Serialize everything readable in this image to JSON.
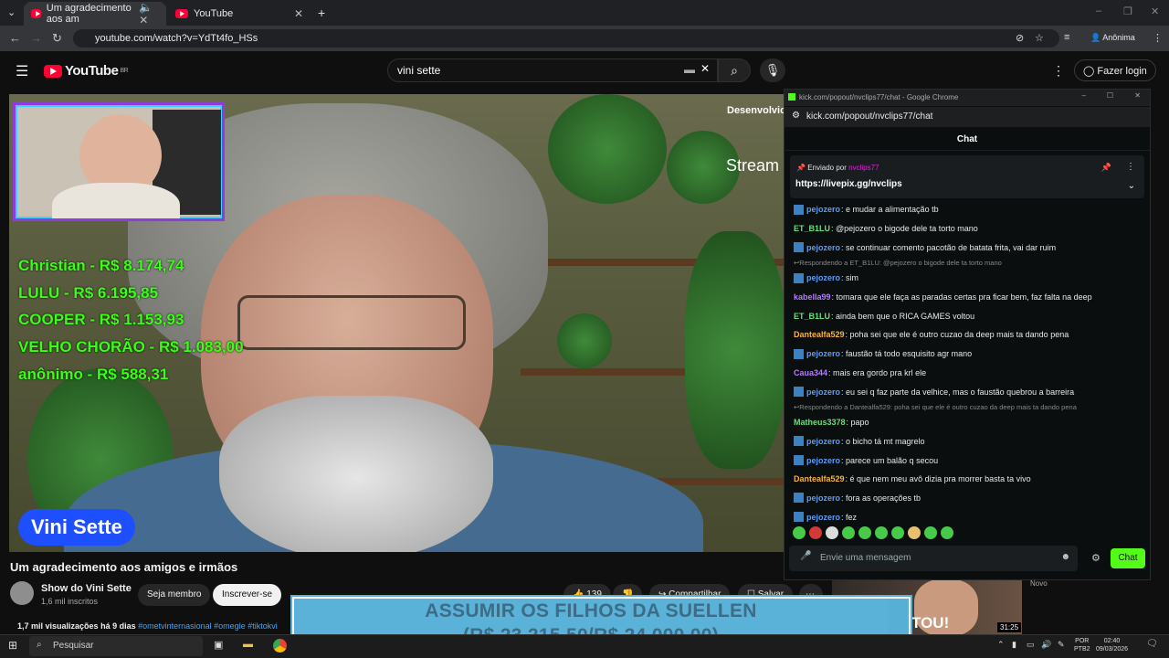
{
  "browser": {
    "tabs": [
      {
        "title": "Um agradecimento aos am"
      },
      {
        "title": "YouTube"
      }
    ],
    "url": "youtube.com/watch?v=YdTt4fo_HSs",
    "profile": "Anônima"
  },
  "youtube": {
    "logo_text": "YouTube",
    "region": "BR",
    "search_value": "vini sette",
    "login_label": "Fazer login",
    "video": {
      "overlay_donors": [
        "Christian - R$ 8.174,74",
        "LULU - R$ 6.195,85",
        "COOPER - R$ 1.153,93",
        "VELHO CHORÃO - R$ 1.083,00",
        "anônimo - R$ 588,31"
      ],
      "name_badge": "Vini Sette",
      "overlay_dev": "Desenvolvic",
      "overlay_stream": "Stream"
    },
    "title": "Um agradecimento aos amigos e irmãos",
    "channel": "Show do Vini Sette",
    "subscribers": "1,6 mil inscritos",
    "member_label": "Seja membro",
    "subscribe_label": "Inscrever-se",
    "likes": "139",
    "share_label": "Compartilhar",
    "save_label": "Salvar",
    "views": "1,7 mil visualizações",
    "age": "há 9 dias",
    "tags": "#ometvinternasional #omegle #tiktokvi",
    "related": {
      "badge": "Novo",
      "duration": "31:25",
      "thumb_text": "TOU!"
    },
    "banner": {
      "line1": "ASSUMIR OS FILHOS DA SUELLEN",
      "line2": "(R$ 23.215,50/R$ 24.000,00)"
    }
  },
  "chat_window": {
    "window_title": "kick.com/popout/nvclips77/chat - Google Chrome",
    "url": "kick.com/popout/nvclips77/chat",
    "header": "Chat",
    "pinned": {
      "sent_by": "Enviado por",
      "user": "nvclips77",
      "link": "https://livepix.gg/nvclips"
    },
    "messages": [
      {
        "user": "pejozero",
        "color": "#5b9df5",
        "badge": true,
        "text": ": e mudar a alimentação tb"
      },
      {
        "user": "ET_B1LU",
        "color": "#66e07a",
        "badge": false,
        "text": ": @pejozero o bigode dele ta torto mano"
      },
      {
        "user": "pejozero",
        "color": "#5b9df5",
        "badge": true,
        "text": ": se continuar comento pacotão de batata frita, vai dar ruim"
      },
      {
        "reply": "Respondendo a ET_B1LU: @pejozero o bigode dele ta torto mano"
      },
      {
        "user": "pejozero",
        "color": "#5b9df5",
        "badge": true,
        "text": ": sim"
      },
      {
        "user": "kabella99",
        "color": "#b47cff",
        "badge": false,
        "text": ": tomara que ele faça as paradas certas pra ficar bem, faz falta na deep"
      },
      {
        "user": "ET_B1LU",
        "color": "#66e07a",
        "badge": false,
        "text": ": ainda bem que o RICA GAMES voltou"
      },
      {
        "user": "Dantealfa529",
        "color": "#f5b342",
        "badge": false,
        "text": ": poha sei que ele é outro cuzao da deep mais ta dando pena"
      },
      {
        "user": "pejozero",
        "color": "#5b9df5",
        "badge": true,
        "text": ": faustão tá todo esquisito agr mano"
      },
      {
        "user": "Caua344",
        "color": "#b47cff",
        "badge": false,
        "text": ": mais era gordo pra krl ele"
      },
      {
        "user": "pejozero",
        "color": "#5b9df5",
        "badge": true,
        "text": ": eu sei q faz parte da velhice, mas o faustão quebrou a barreira"
      },
      {
        "reply": "Respondendo a Dantealfa529: poha sei que ele é outro cuzao da deep mais ta dando pena"
      },
      {
        "user": "Matheus3378",
        "color": "#66e07a",
        "badge": false,
        "text": ": papo"
      },
      {
        "user": "pejozero",
        "color": "#5b9df5",
        "badge": true,
        "text": ": o bicho tá mt magrelo"
      },
      {
        "user": "pejozero",
        "color": "#5b9df5",
        "badge": true,
        "text": ": parece um balão q secou"
      },
      {
        "user": "Dantealfa529",
        "color": "#f5b342",
        "badge": false,
        "text": ": é que nem meu avô dizia pra morrer basta ta vivo"
      },
      {
        "user": "pejozero",
        "color": "#5b9df5",
        "badge": true,
        "text": ": fora as operações tb"
      },
      {
        "user": "pejozero",
        "color": "#5b9df5",
        "badge": true,
        "text": ": fez"
      }
    ],
    "input_placeholder": "Envie uma mensagem",
    "send_label": "Chat",
    "accent": "#53fc18"
  },
  "taskbar": {
    "search_placeholder": "Pesquisar",
    "lang1": "POR",
    "lang2": "PTB2",
    "time": "02:40",
    "date": "09/03/2026"
  }
}
